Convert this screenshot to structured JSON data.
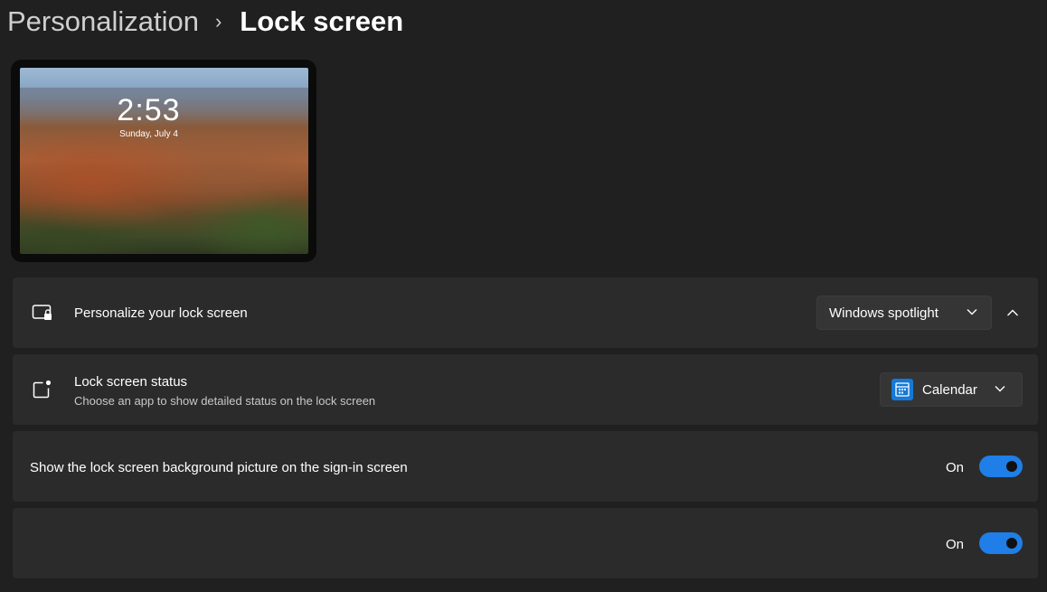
{
  "breadcrumb": {
    "parent": "Personalization",
    "separator": "›",
    "current": "Lock screen"
  },
  "preview": {
    "time": "2:53",
    "date": "Sunday, July 4"
  },
  "personalize": {
    "title": "Personalize your lock screen",
    "icon": "lock-screen-icon",
    "selected": "Windows spotlight",
    "expanded": true
  },
  "status": {
    "title": "Lock screen status",
    "subtitle": "Choose an app to show detailed status on the lock screen",
    "icon": "status-icon",
    "selected": "Calendar",
    "app_icon": "calendar-icon"
  },
  "signin_background": {
    "title": "Show the lock screen background picture on the sign-in screen",
    "state_label": "On",
    "checked": true
  },
  "extra_toggle": {
    "state_label": "On",
    "checked": true
  },
  "colors": {
    "accent": "#1f7ee8",
    "card_bg": "#2b2b2b",
    "page_bg": "#202020"
  }
}
